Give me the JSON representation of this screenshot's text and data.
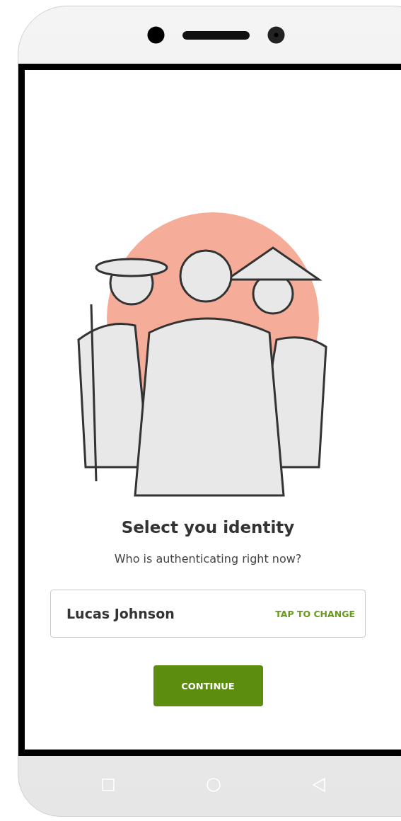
{
  "screen": {
    "title": "Select you identity",
    "subtitle": "Who is authenticating right now?",
    "identity": {
      "name": "Lucas Johnson",
      "action": "TAP TO CHANGE"
    },
    "button": {
      "label": "CONTINUE"
    }
  }
}
